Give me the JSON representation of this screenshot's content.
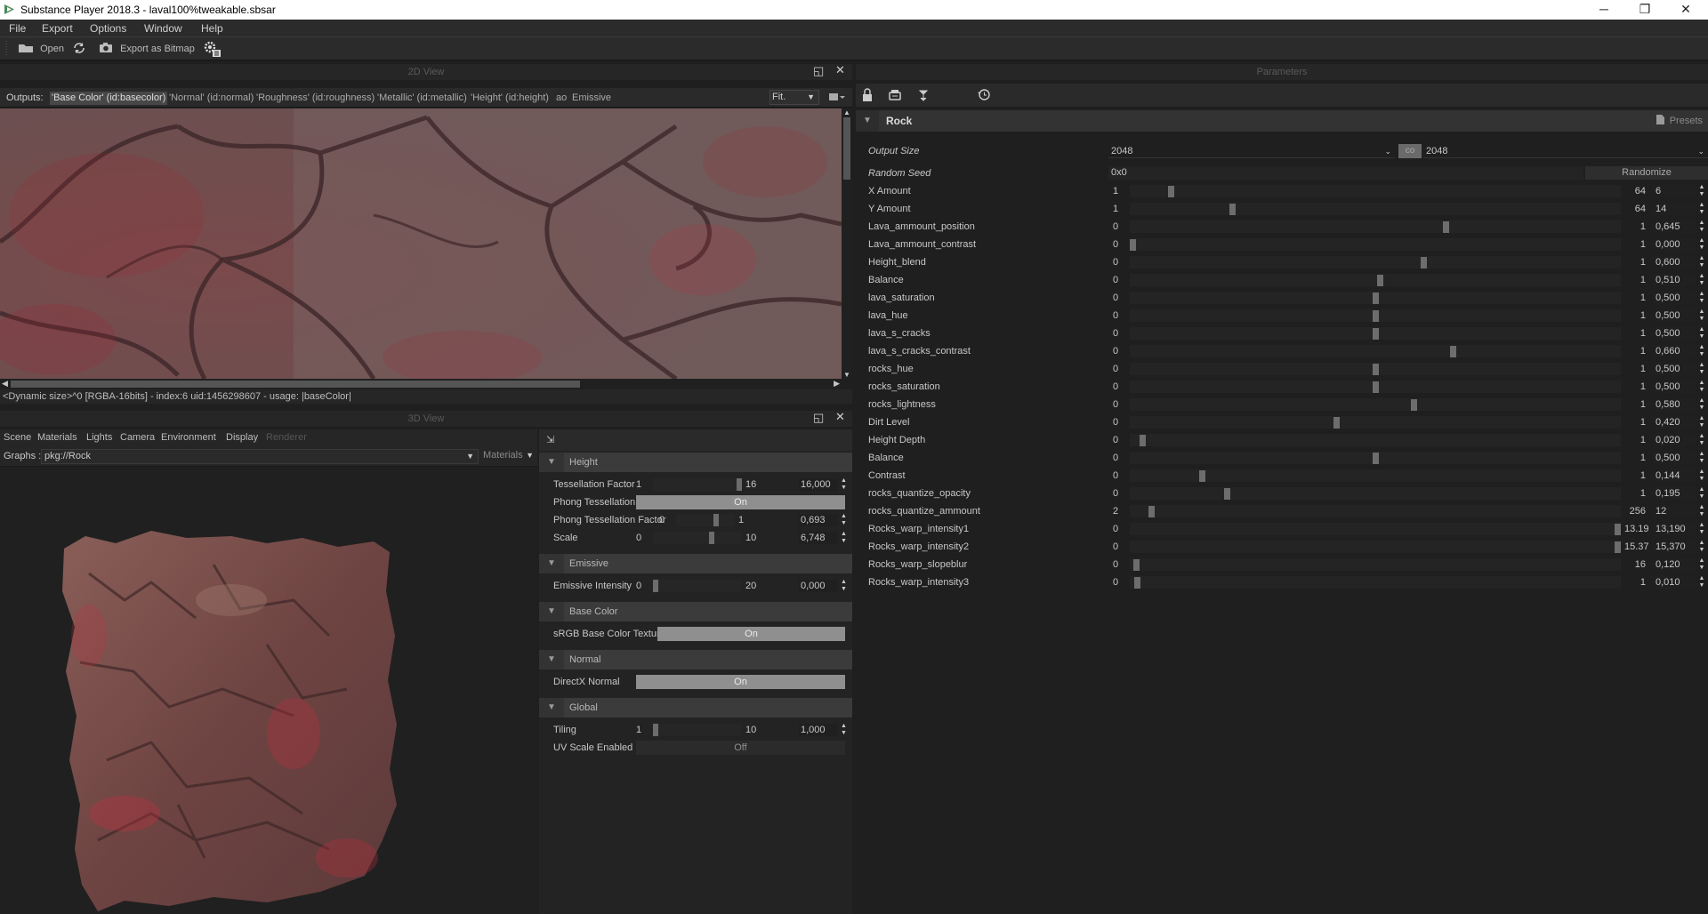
{
  "window": {
    "title": "Substance Player 2018.3 - laval100%tweakable.sbsar",
    "minimize": "─",
    "maximize": "❐",
    "close": "✕"
  },
  "menu": [
    "File",
    "Export",
    "Options",
    "Window",
    "Help"
  ],
  "toolbar": {
    "open": "Open",
    "export": "Export as Bitmap"
  },
  "view2d": {
    "title": "2D View",
    "outputs_label": "Outputs:",
    "tabs": [
      "'Base Color' (id:basecolor)",
      "'Normal' (id:normal)",
      "'Roughness' (id:roughness)",
      "'Metallic' (id:metallic)",
      "'Height' (id:height)",
      "ao",
      "Emissive"
    ],
    "fit": "Fit.",
    "status": "<Dynamic size>^0 [RGBA-16bits] - index:6 uid:1456298607 - usage: |baseColor|"
  },
  "view3d": {
    "title": "3D View",
    "menus": [
      "Scene",
      "Materials",
      "Lights",
      "Camera",
      "Environment",
      "Display",
      "Renderer"
    ],
    "graphs_label": "Graphs :",
    "graph_value": "pkg://Rock",
    "materials_label": "Materials"
  },
  "material": {
    "sections": [
      {
        "name": "Height",
        "rows": [
          {
            "type": "slider",
            "label": "Tessellation Factor",
            "min": "1",
            "max": "16",
            "value": "16,000",
            "frac": 1.0
          },
          {
            "type": "toggle",
            "label": "Phong Tessellation",
            "value": "On"
          },
          {
            "type": "slider",
            "label": "Phong Tessellation Factor",
            "min": "0",
            "max": "1",
            "value": "0,693",
            "frac": 0.693
          },
          {
            "type": "slider",
            "label": "Scale",
            "min": "0",
            "max": "10",
            "value": "6,748",
            "frac": 0.6748
          }
        ]
      },
      {
        "name": "Emissive",
        "rows": [
          {
            "type": "slider",
            "label": "Emissive Intensity",
            "min": "0",
            "max": "20",
            "value": "0,000",
            "frac": 0.0
          }
        ]
      },
      {
        "name": "Base Color",
        "rows": [
          {
            "type": "toggle",
            "label": "sRGB Base Color Texture",
            "value": "On"
          }
        ]
      },
      {
        "name": "Normal",
        "rows": [
          {
            "type": "toggle",
            "label": "DirectX Normal",
            "value": "On"
          }
        ]
      },
      {
        "name": "Global",
        "rows": [
          {
            "type": "slider",
            "label": "Tiling",
            "min": "1",
            "max": "10",
            "value": "1,000",
            "frac": 0.0
          },
          {
            "type": "toggle",
            "label": "UV Scale Enabled",
            "value": "Off"
          }
        ]
      }
    ]
  },
  "params": {
    "title": "Parameters",
    "group": "Rock",
    "presets": "Presets",
    "output_size": {
      "label": "Output Size",
      "w": "2048",
      "h": "2048",
      "link": "co"
    },
    "random_seed": {
      "label": "Random Seed",
      "value": "0x0",
      "button": "Randomize"
    },
    "rows": [
      {
        "label": "X Amount",
        "min": "1",
        "max": "64",
        "value": "6",
        "frac": 0.079
      },
      {
        "label": "Y Amount",
        "min": "1",
        "max": "64",
        "value": "14",
        "frac": 0.206
      },
      {
        "label": "Lava_ammount_position",
        "min": "0",
        "max": "1",
        "value": "0,645",
        "frac": 0.645
      },
      {
        "label": "Lava_ammount_contrast",
        "min": "0",
        "max": "1",
        "value": "0,000",
        "frac": 0.0
      },
      {
        "label": "Height_blend",
        "min": "0",
        "max": "1",
        "value": "0,600",
        "frac": 0.6
      },
      {
        "label": "Balance",
        "min": "0",
        "max": "1",
        "value": "0,510",
        "frac": 0.51
      },
      {
        "label": "lava_saturation",
        "min": "0",
        "max": "1",
        "value": "0,500",
        "frac": 0.5
      },
      {
        "label": "lava_hue",
        "min": "0",
        "max": "1",
        "value": "0,500",
        "frac": 0.5
      },
      {
        "label": "lava_s_cracks",
        "min": "0",
        "max": "1",
        "value": "0,500",
        "frac": 0.5
      },
      {
        "label": "lava_s_cracks_contrast",
        "min": "0",
        "max": "1",
        "value": "0,660",
        "frac": 0.66
      },
      {
        "label": "rocks_hue",
        "min": "0",
        "max": "1",
        "value": "0,500",
        "frac": 0.5
      },
      {
        "label": "rocks_saturation",
        "min": "0",
        "max": "1",
        "value": "0,500",
        "frac": 0.5
      },
      {
        "label": "rocks_lightness",
        "min": "0",
        "max": "1",
        "value": "0,580",
        "frac": 0.58
      },
      {
        "label": "Dirt Level",
        "min": "0",
        "max": "1",
        "value": "0,420",
        "frac": 0.42
      },
      {
        "label": "Height Depth",
        "min": "0",
        "max": "1",
        "value": "0,020",
        "frac": 0.02
      },
      {
        "label": "Balance",
        "min": "0",
        "max": "1",
        "value": "0,500",
        "frac": 0.5
      },
      {
        "label": "Contrast",
        "min": "0",
        "max": "1",
        "value": "0,144",
        "frac": 0.144
      },
      {
        "label": "rocks_quantize_opacity",
        "min": "0",
        "max": "1",
        "value": "0,195",
        "frac": 0.195
      },
      {
        "label": "rocks_quantize_ammount",
        "min": "2",
        "max": "256",
        "value": "12",
        "frac": 0.039
      },
      {
        "label": "Rocks_warp_intensity1",
        "min": "0",
        "max": "13.19",
        "value": "13,190",
        "frac": 1.0
      },
      {
        "label": "Rocks_warp_intensity2",
        "min": "0",
        "max": "15.37",
        "value": "15,370",
        "frac": 1.0
      },
      {
        "label": "Rocks_warp_slopeblur",
        "min": "0",
        "max": "16",
        "value": "0,120",
        "frac": 0.0075
      },
      {
        "label": "Rocks_warp_intensity3",
        "min": "0",
        "max": "1",
        "value": "0,010",
        "frac": 0.01
      }
    ]
  }
}
